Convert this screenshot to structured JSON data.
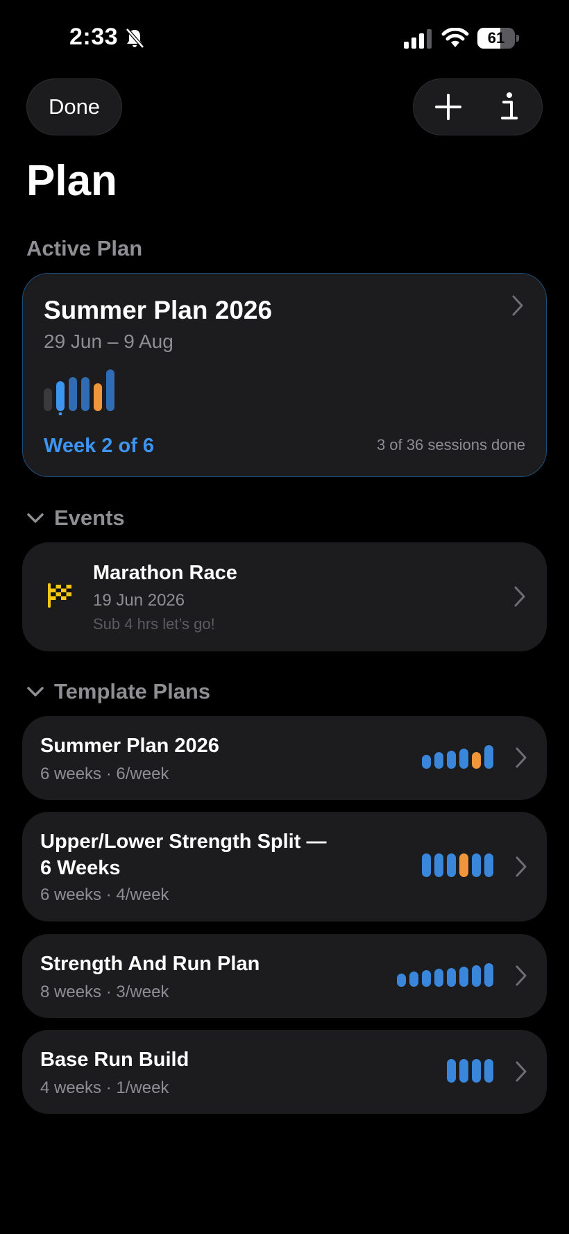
{
  "status_bar": {
    "time": "2:33",
    "battery_percent": 61,
    "battery_label": "61"
  },
  "nav": {
    "done_label": "Done"
  },
  "page_title": "Plan",
  "active_section_label": "Active Plan",
  "active_plan": {
    "title": "Summer Plan 2026",
    "dates": "29 Jun – 9 Aug",
    "week_label": "Week 2 of 6",
    "sessions_label": "3 of 36 sessions done",
    "current_week": 2,
    "weeks": [
      {
        "level": 0.55,
        "color": "#3a3a3c"
      },
      {
        "level": 0.72,
        "color": "#3d94f1"
      },
      {
        "level": 0.82,
        "color": "#2f6cb3"
      },
      {
        "level": 0.82,
        "color": "#2f6cb3"
      },
      {
        "level": 0.66,
        "color": "#f0963a"
      },
      {
        "level": 1.0,
        "color": "#2f6cb3"
      }
    ]
  },
  "events_section": {
    "label": "Events",
    "items": [
      {
        "title": "Marathon Race",
        "date": "19 Jun 2026",
        "note": "Sub 4 hrs let’s go!",
        "icon": "checkered-flag-icon"
      }
    ]
  },
  "templates_section": {
    "label": "Template Plans",
    "items": [
      {
        "name_line1": "Summer Plan 2026",
        "name_line2": "",
        "meta": "6 weeks · 6/week",
        "bars": [
          0.6,
          0.7,
          0.75,
          0.85,
          0.7,
          1.0
        ],
        "highlight_index": 4
      },
      {
        "name_line1": "Upper/Lower Strength Split —",
        "name_line2": "6 Weeks",
        "meta": "6 weeks · 4/week",
        "bars": [
          1,
          1,
          1,
          1,
          1,
          1
        ],
        "highlight_index": 3
      },
      {
        "name_line1": "Strength And Run Plan",
        "name_line2": "",
        "meta": "8 weeks · 3/week",
        "bars": [
          0.55,
          0.65,
          0.7,
          0.75,
          0.8,
          0.85,
          0.9,
          1.0
        ],
        "highlight_index": -1
      },
      {
        "name_line1": "Base Run Build",
        "name_line2": "",
        "meta": "4 weeks · 1/week",
        "bars": [
          1,
          1,
          1,
          1
        ],
        "highlight_index": -1
      }
    ]
  },
  "colors": {
    "accent_blue": "#3d94f1",
    "bar_blue": "#3a86da",
    "bar_orange": "#f0963a",
    "card": "#1c1c1e",
    "secondary_text": "#8e8e93"
  }
}
